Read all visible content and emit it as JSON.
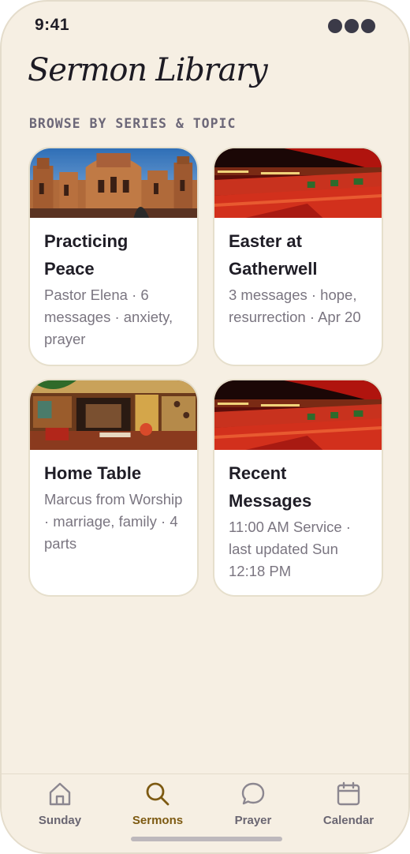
{
  "status": {
    "time": "9:41"
  },
  "page": {
    "title": "Sermon Library",
    "section_label": "BROWSE BY SERIES & TOPIC"
  },
  "cards": [
    {
      "title": "Practicing Peace",
      "meta": "Pastor Elena · 6 messages · anxiety, prayer",
      "image": "ornate-palace-photo"
    },
    {
      "title": "Easter at Gatherwell",
      "meta": "3 messages · hope, resurrection · Apr 20",
      "image": "church-auditorium-photo"
    },
    {
      "title": "Home Table",
      "meta": "Marcus from Worship · marriage, family · 4 parts",
      "image": "restaurant-interior-photo"
    },
    {
      "title": "Recent Messages",
      "meta": "11:00 AM Service · last updated Sun 12:18 PM",
      "image": "church-auditorium-photo"
    }
  ],
  "tabs": [
    {
      "label": "Sunday",
      "icon": "home-icon",
      "active": false
    },
    {
      "label": "Sermons",
      "icon": "search-icon",
      "active": true
    },
    {
      "label": "Prayer",
      "icon": "chat-bubble-icon",
      "active": false
    },
    {
      "label": "Calendar",
      "icon": "calendar-icon",
      "active": false
    }
  ],
  "colors": {
    "background": "#f6efe3",
    "accent": "#7d5a12",
    "tab_inactive": "#6a6672",
    "card_border": "#e6dfcc"
  }
}
